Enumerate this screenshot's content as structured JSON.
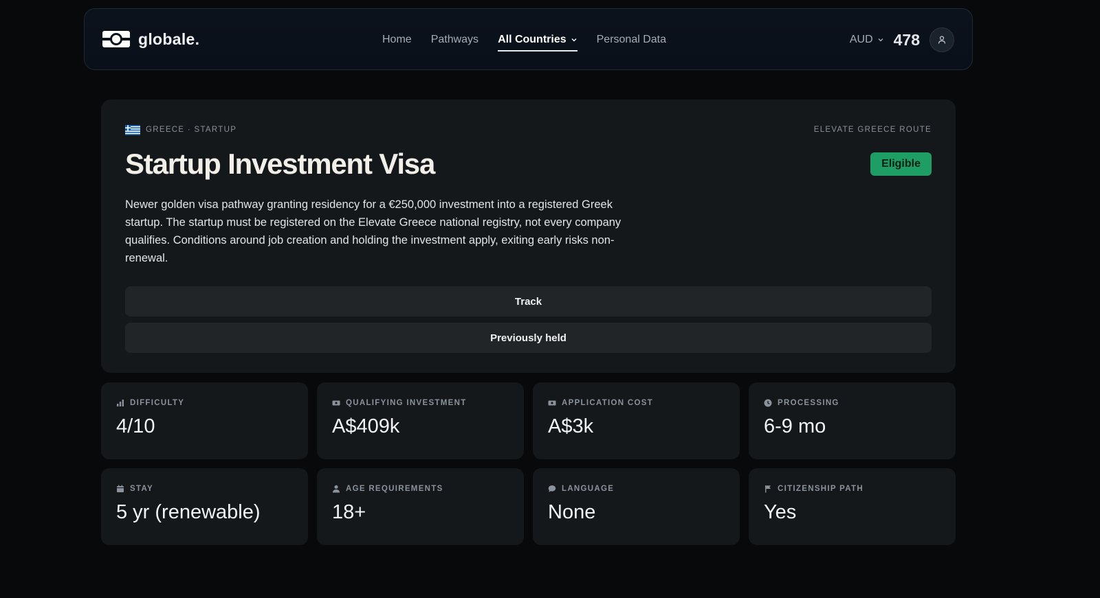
{
  "nav": {
    "logo_text": "globale.",
    "links": [
      {
        "label": "Home"
      },
      {
        "label": "Pathways"
      },
      {
        "label": "All Countries"
      },
      {
        "label": "Personal Data"
      }
    ],
    "active_link": "All Countries",
    "currency": "AUD",
    "points": "478"
  },
  "hero": {
    "flag": "greece-flag",
    "crumb": "GREECE · STARTUP",
    "route_tag": "ELEVATE GREECE ROUTE",
    "title": "Startup Investment Visa",
    "status": "Eligible",
    "description": "Newer golden visa pathway granting residency for a €250,000 investment into a registered Greek startup. The startup must be registered on the Elevate Greece national registry, not every company qualifies. Conditions around job creation and holding the investment apply, exiting early risks non-renewal.",
    "track_label": "Track",
    "previously_held_label": "Previously held"
  },
  "stats": [
    {
      "icon": "bar-chart-icon",
      "label": "DIFFICULTY",
      "value": "4/10"
    },
    {
      "icon": "cash-icon",
      "label": "QUALIFYING INVESTMENT",
      "value": "A$409k"
    },
    {
      "icon": "cash-icon",
      "label": "APPLICATION COST",
      "value": "A$3k"
    },
    {
      "icon": "clock-icon",
      "label": "PROCESSING",
      "value": "6-9 mo"
    },
    {
      "icon": "calendar-icon",
      "label": "STAY",
      "value": "5 yr (renewable)"
    },
    {
      "icon": "person-icon",
      "label": "AGE REQUIREMENTS",
      "value": "18+"
    },
    {
      "icon": "speech-bubble-icon",
      "label": "LANGUAGE",
      "value": "None"
    },
    {
      "icon": "flag-icon",
      "label": "CITIZENSHIP PATH",
      "value": "Yes"
    }
  ],
  "colors": {
    "background": "#07090b",
    "card": "#15181b",
    "eligible": "#1e9e64"
  }
}
